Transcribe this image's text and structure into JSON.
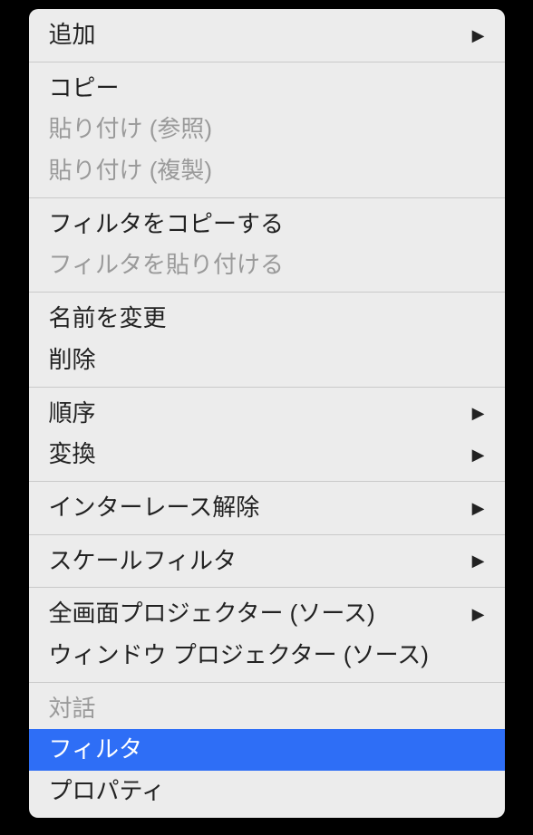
{
  "menu": {
    "groups": [
      [
        {
          "label": "追加",
          "submenu": true,
          "disabled": false
        }
      ],
      [
        {
          "label": "コピー",
          "submenu": false,
          "disabled": false
        },
        {
          "label": "貼り付け (参照)",
          "submenu": false,
          "disabled": true
        },
        {
          "label": "貼り付け (複製)",
          "submenu": false,
          "disabled": true
        }
      ],
      [
        {
          "label": "フィルタをコピーする",
          "submenu": false,
          "disabled": false
        },
        {
          "label": "フィルタを貼り付ける",
          "submenu": false,
          "disabled": true
        }
      ],
      [
        {
          "label": "名前を変更",
          "submenu": false,
          "disabled": false
        },
        {
          "label": "削除",
          "submenu": false,
          "disabled": false
        }
      ],
      [
        {
          "label": "順序",
          "submenu": true,
          "disabled": false
        },
        {
          "label": "変換",
          "submenu": true,
          "disabled": false
        }
      ],
      [
        {
          "label": "インターレース解除",
          "submenu": true,
          "disabled": false
        }
      ],
      [
        {
          "label": "スケールフィルタ",
          "submenu": true,
          "disabled": false
        }
      ],
      [
        {
          "label": "全画面プロジェクター (ソース)",
          "submenu": true,
          "disabled": false
        },
        {
          "label": "ウィンドウ プロジェクター (ソース)",
          "submenu": false,
          "disabled": false
        }
      ],
      [
        {
          "label": "対話",
          "submenu": false,
          "disabled": true
        },
        {
          "label": "フィルタ",
          "submenu": false,
          "disabled": false,
          "selected": true
        },
        {
          "label": "プロパティ",
          "submenu": false,
          "disabled": false
        }
      ]
    ]
  }
}
